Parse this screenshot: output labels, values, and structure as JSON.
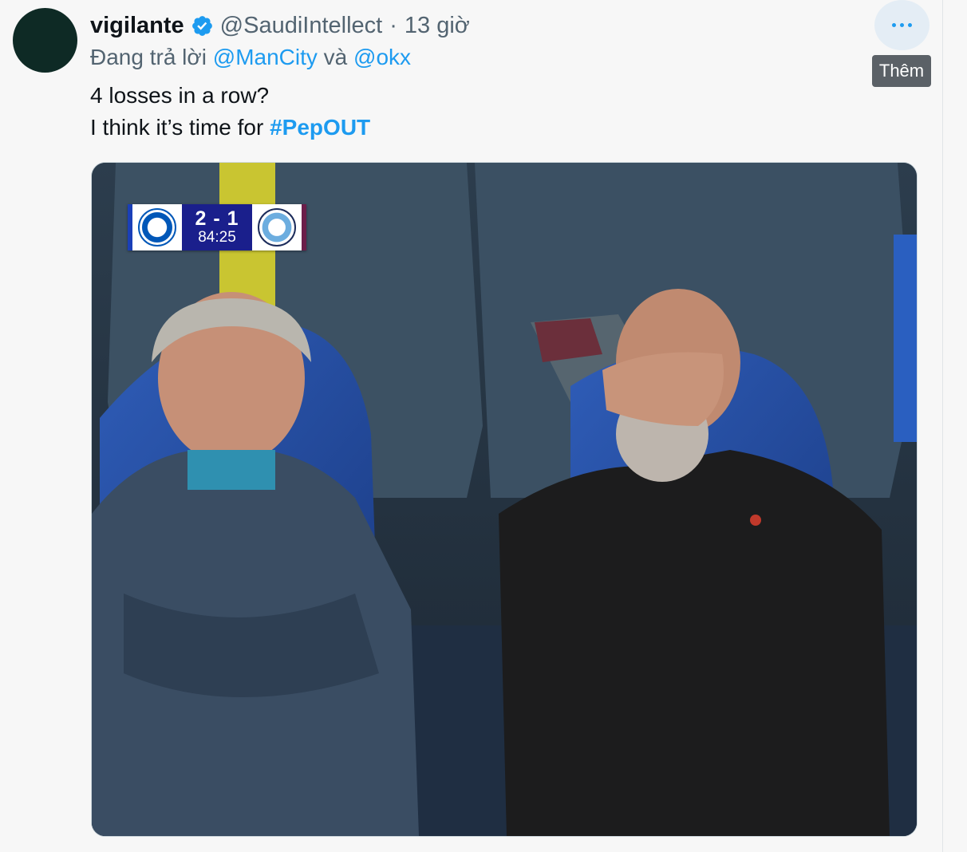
{
  "tweet": {
    "display_name": "vigilante",
    "handle": "@SaudiIntellect",
    "separator": "·",
    "time": "13 giờ",
    "reply_prefix": "Đang trả lời",
    "reply_mention_1": "@ManCity",
    "reply_join": "và",
    "reply_mention_2": "@okx",
    "text_line_1": "4 losses in a row?",
    "text_line_2_prefix": "I think it’s time for",
    "hashtag": "#PepOUT"
  },
  "more_menu": {
    "icon": "more-horizontal-icon",
    "tooltip": "Thêm"
  },
  "media": {
    "scorebug": {
      "score": "2 - 1",
      "clock": "84:25"
    }
  },
  "colors": {
    "accent": "#1d9bf0",
    "secondary_text": "#536471",
    "primary_text": "#0f1419",
    "background": "#f7f7f7"
  }
}
